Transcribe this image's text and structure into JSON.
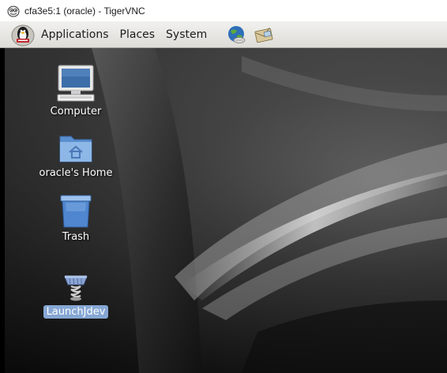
{
  "window": {
    "title": "cfa3e5:1 (oracle) - TigerVNC"
  },
  "panel": {
    "menus": [
      {
        "label": "Applications"
      },
      {
        "label": "Places"
      },
      {
        "label": "System"
      }
    ],
    "launchers": [
      {
        "icon": "web-browser-icon"
      },
      {
        "icon": "mail-client-icon"
      }
    ]
  },
  "desktop": {
    "icons": [
      {
        "label": "Computer",
        "icon": "computer-icon"
      },
      {
        "label": "oracle's Home",
        "icon": "home-folder-icon"
      },
      {
        "label": "Trash",
        "icon": "trash-icon"
      },
      {
        "label": "LaunchJdev",
        "icon": "launcher-script-icon",
        "selected": true
      }
    ]
  },
  "colors": {
    "panel": "#e6e4e0",
    "selection": "#86a7d4",
    "folder": "#6f9fd6"
  }
}
